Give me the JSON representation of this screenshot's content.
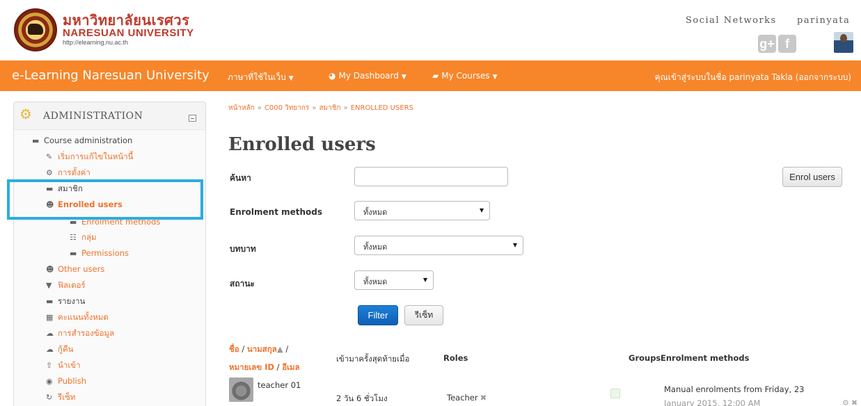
{
  "header": {
    "brand_thai": "มหาวิทยาลัยนเรศวร",
    "brand_en": "NARESUAN UNIVERSITY",
    "brand_url": "http://elearning.nu.ac.th",
    "social_title": "Social Networks",
    "user_title": "parinyata",
    "social_icons": [
      "google-plus-icon",
      "facebook-icon"
    ],
    "gplus_glyph": "g+",
    "fb_glyph": "f"
  },
  "navbar": {
    "brand": "e-Learning Naresuan University",
    "lang_label": "ภาษาที่ใช้ในเว็บ",
    "dashboard_label": "My Dashboard",
    "courses_label": "My Courses",
    "login_status": "คุณเข้าสู่ระบบในชื่อ parinyata Takla (ออกจากระบบ)",
    "bg_color": "#f7852a"
  },
  "sidebar": {
    "title": "ADMINISTRATION",
    "items": [
      {
        "label": "Course administration",
        "icon": "folder-open-icon"
      },
      {
        "label": "เริ่มการแก้ไขในหน้านี้",
        "icon": "pencil-icon"
      },
      {
        "label": "การตั้งค่า",
        "icon": "gear-icon"
      },
      {
        "label": "สมาชิก",
        "icon": "folder-open-icon"
      },
      {
        "label": "Enrolled users",
        "icon": "user-icon"
      },
      {
        "label": "Enrolment methods",
        "icon": "folder-icon"
      },
      {
        "label": "กลุ่ม",
        "icon": "group-icon"
      },
      {
        "label": "Permissions",
        "icon": "folder-icon"
      },
      {
        "label": "Other users",
        "icon": "user-icon"
      },
      {
        "label": "ฟิลเตอร์",
        "icon": "filter-icon"
      },
      {
        "label": "รายงาน",
        "icon": "folder-icon"
      },
      {
        "label": "คะแนนทั้งหมด",
        "icon": "table-icon"
      },
      {
        "label": "การสำรองข้อมูล",
        "icon": "cloud-upload-icon"
      },
      {
        "label": "กู้คืน",
        "icon": "cloud-download-icon"
      },
      {
        "label": "นำเข้า",
        "icon": "upload-icon"
      },
      {
        "label": "Publish",
        "icon": "globe-icon"
      },
      {
        "label": "รีเซ็ท",
        "icon": "refresh-icon"
      }
    ]
  },
  "breadcrumb": {
    "items": [
      "หน้าหลัก",
      "C000 วิทยากร",
      "สมาชิก",
      "ENROLLED USERS"
    ],
    "separator": "»"
  },
  "main": {
    "title": "Enrolled users",
    "search_label": "ค้นหา",
    "search_value": "",
    "enrol_methods_label": "Enrolment methods",
    "enrol_methods_value": "ทั้งหมด",
    "role_label": "บทบาท",
    "role_value": "ทั้งหมด",
    "status_label": "สถานะ",
    "status_value": "ทั้งหมด",
    "enrol_button": "Enrol users",
    "filter_button": "Filter",
    "reset_button": "รีเซ็ท"
  },
  "table": {
    "headers": {
      "first_name": "ชื่อ",
      "last_name": "นามสกุล",
      "sort_indicator": "▲",
      "id_number": "หมายเลข ID",
      "email": "อีเมล",
      "last_access": "เข้ามาครั้งสุดท้ายเมื่อ",
      "roles": "Roles",
      "groups": "Groups",
      "enrolment_methods": "Enrolment methods"
    },
    "rows": [
      {
        "name": "teacher 01",
        "last_access": "2 วัน 6 ชั่วโมง",
        "role": "Teacher",
        "enrolment": "Manual enrolments from Friday, 23",
        "enrolment_cont": "January 2015, 12:00 AM"
      }
    ]
  },
  "annotation": {
    "highlight_color": "#2bace2"
  }
}
